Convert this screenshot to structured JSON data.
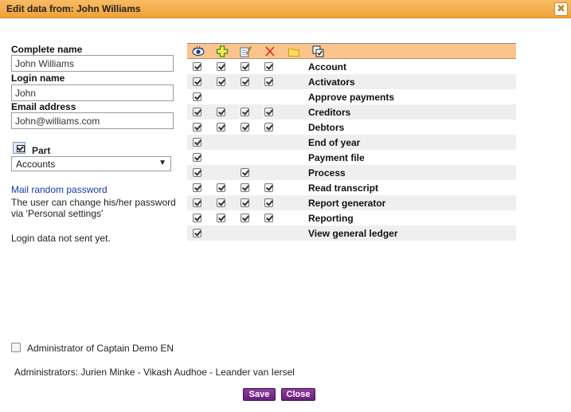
{
  "dialog": {
    "title": "Edit data from: John Williams",
    "close_glyph": "✖"
  },
  "form": {
    "complete_name": {
      "label": "Complete name",
      "value": "John Williams"
    },
    "login_name": {
      "label": "Login name",
      "value": "John"
    },
    "email": {
      "label": "Email address",
      "value": "John@williams.com"
    },
    "part": {
      "label": "Part",
      "selected": "Accounts",
      "icon": "checkbox-copy-icon"
    }
  },
  "password": {
    "link": "Mail random password",
    "info": "The user can change his/her password via 'Personal settings'",
    "status": "Login data not sent yet."
  },
  "permissions": {
    "header_icons": [
      "view-eye-icon",
      "add-plus-icon",
      "edit-notepad-icon",
      "delete-x-icon",
      "folder-icon",
      "checkbox-copy-icon"
    ],
    "rows": [
      {
        "name": "Account",
        "flags": [
          true,
          true,
          true,
          true
        ]
      },
      {
        "name": "Activators",
        "flags": [
          true,
          true,
          true,
          true
        ]
      },
      {
        "name": "Approve payments",
        "flags": [
          true,
          false,
          false,
          false
        ]
      },
      {
        "name": "Creditors",
        "flags": [
          true,
          true,
          true,
          true
        ]
      },
      {
        "name": "Debtors",
        "flags": [
          true,
          true,
          true,
          true
        ]
      },
      {
        "name": "End of year",
        "flags": [
          true,
          false,
          false,
          false
        ]
      },
      {
        "name": "Payment file",
        "flags": [
          true,
          false,
          false,
          false
        ]
      },
      {
        "name": "Process",
        "flags": [
          true,
          false,
          true,
          false
        ]
      },
      {
        "name": "Read transcript",
        "flags": [
          true,
          true,
          true,
          true
        ]
      },
      {
        "name": "Report generator",
        "flags": [
          true,
          true,
          true,
          true
        ]
      },
      {
        "name": "Reporting",
        "flags": [
          true,
          true,
          true,
          true
        ]
      },
      {
        "name": "View general ledger",
        "flags": [
          true,
          false,
          false,
          false
        ]
      }
    ]
  },
  "admin": {
    "checkbox_label": "Administrator of Captain Demo EN",
    "checked": false,
    "administrators": "Administrators: Jurien Minke - Vikash Audhoe - Leander van Iersel"
  },
  "buttons": {
    "save": "Save",
    "close": "Close"
  },
  "colors": {
    "title_bar": "#f0a238",
    "table_header": "#fbc48d",
    "button": "#7a2a8c",
    "link": "#1a39b0"
  }
}
